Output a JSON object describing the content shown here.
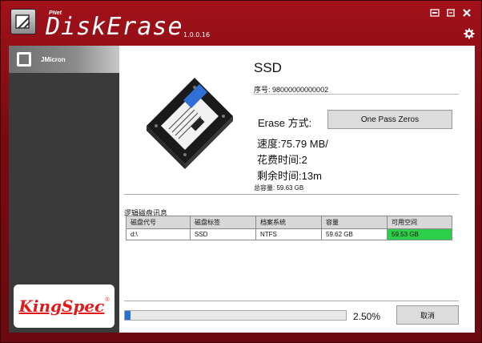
{
  "app": {
    "brand": "PNet",
    "name": "DiskErase",
    "version": "1.0.0.16"
  },
  "window_controls": {
    "restore_icon": "restore-icon",
    "resize_icon": "resize-icon",
    "close_icon": "close-icon"
  },
  "sidebar": {
    "items": [
      {
        "label": "JMicron",
        "icon": "drive-icon"
      }
    ],
    "logo": {
      "text": "KingSpec",
      "reg": "®"
    }
  },
  "device": {
    "name": "SSD",
    "serial": "序号: 98000000000002",
    "erase_label": "Erase 方式:",
    "erase_method": "One Pass Zeros",
    "speed": "速度:75.79 MB/",
    "elapsed": "花费时间:2",
    "remaining": "剩余时间:13m",
    "capacity": "总容量: 59.63 GB"
  },
  "volumes": {
    "section_label": "逻辑磁盘讯息",
    "columns": [
      "磁盘代号",
      "磁盘标签",
      "档案系统",
      "容量",
      "可用空间"
    ],
    "rows": [
      [
        "d:\\",
        "SSD",
        "NTFS",
        "59.62 GB",
        "59.53 GB"
      ]
    ]
  },
  "progress": {
    "percent_text": "2.50%",
    "fraction": 0.025
  },
  "cancel_label": "取消",
  "colors": {
    "title_red": "#a2111a",
    "progress_blue": "#2b6fd4",
    "free_green": "#2ccf4a",
    "logo_red": "#e01b1b"
  }
}
